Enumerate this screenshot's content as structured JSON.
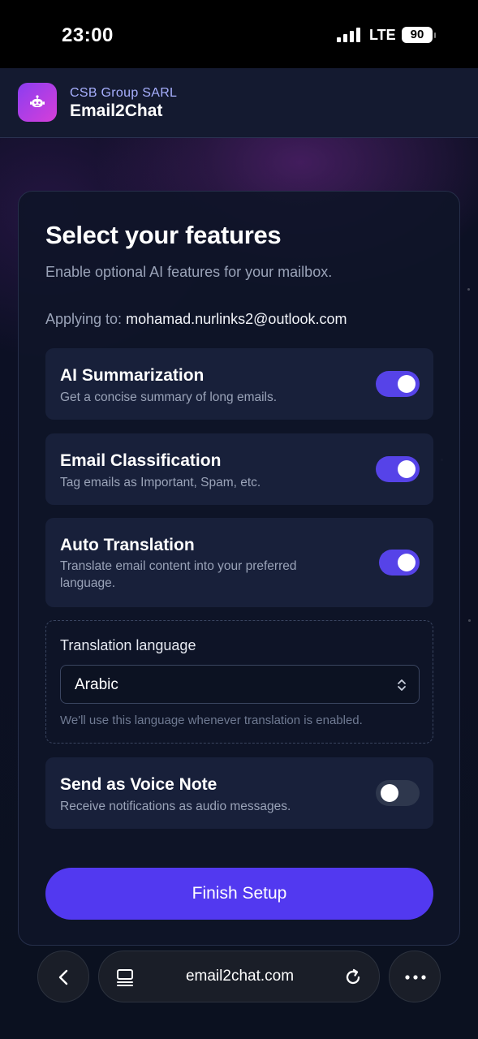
{
  "status_bar": {
    "time": "23:00",
    "network": "LTE",
    "battery": "90",
    "icons": [
      "signal-bars-icon",
      "battery-icon"
    ]
  },
  "app_header": {
    "organization": "CSB Group SARL",
    "app_name": "Email2Chat",
    "logo_icon": "robot-icon"
  },
  "setup": {
    "title": "Select your features",
    "subtitle": "Enable optional AI features for your mailbox.",
    "applying_label": "Applying to:",
    "applying_email": "mohamad.nurlinks2@outlook.com",
    "features": [
      {
        "title": "AI Summarization",
        "description": "Get a concise summary of long emails.",
        "enabled": true
      },
      {
        "title": "Email Classification",
        "description": "Tag emails as Important, Spam, etc.",
        "enabled": true
      },
      {
        "title": "Auto Translation",
        "description": "Translate email content into your preferred language.",
        "enabled": true
      },
      {
        "title": "Send as Voice Note",
        "description": "Receive notifications as audio messages.",
        "enabled": false
      }
    ],
    "translation": {
      "label": "Translation language",
      "selected": "Arabic",
      "hint": "We'll use this language whenever translation is enabled."
    },
    "finish_label": "Finish Setup"
  },
  "browser": {
    "url": "email2chat.com",
    "icons": [
      "back-icon",
      "tabs-icon",
      "reload-icon",
      "more-icon"
    ]
  },
  "colors": {
    "accent": "#5239f0",
    "toggle_on": "#5643e8",
    "toggle_off": "#2e374d",
    "logo_gradient_start": "#8b3df0",
    "logo_gradient_end": "#d63fd9"
  }
}
